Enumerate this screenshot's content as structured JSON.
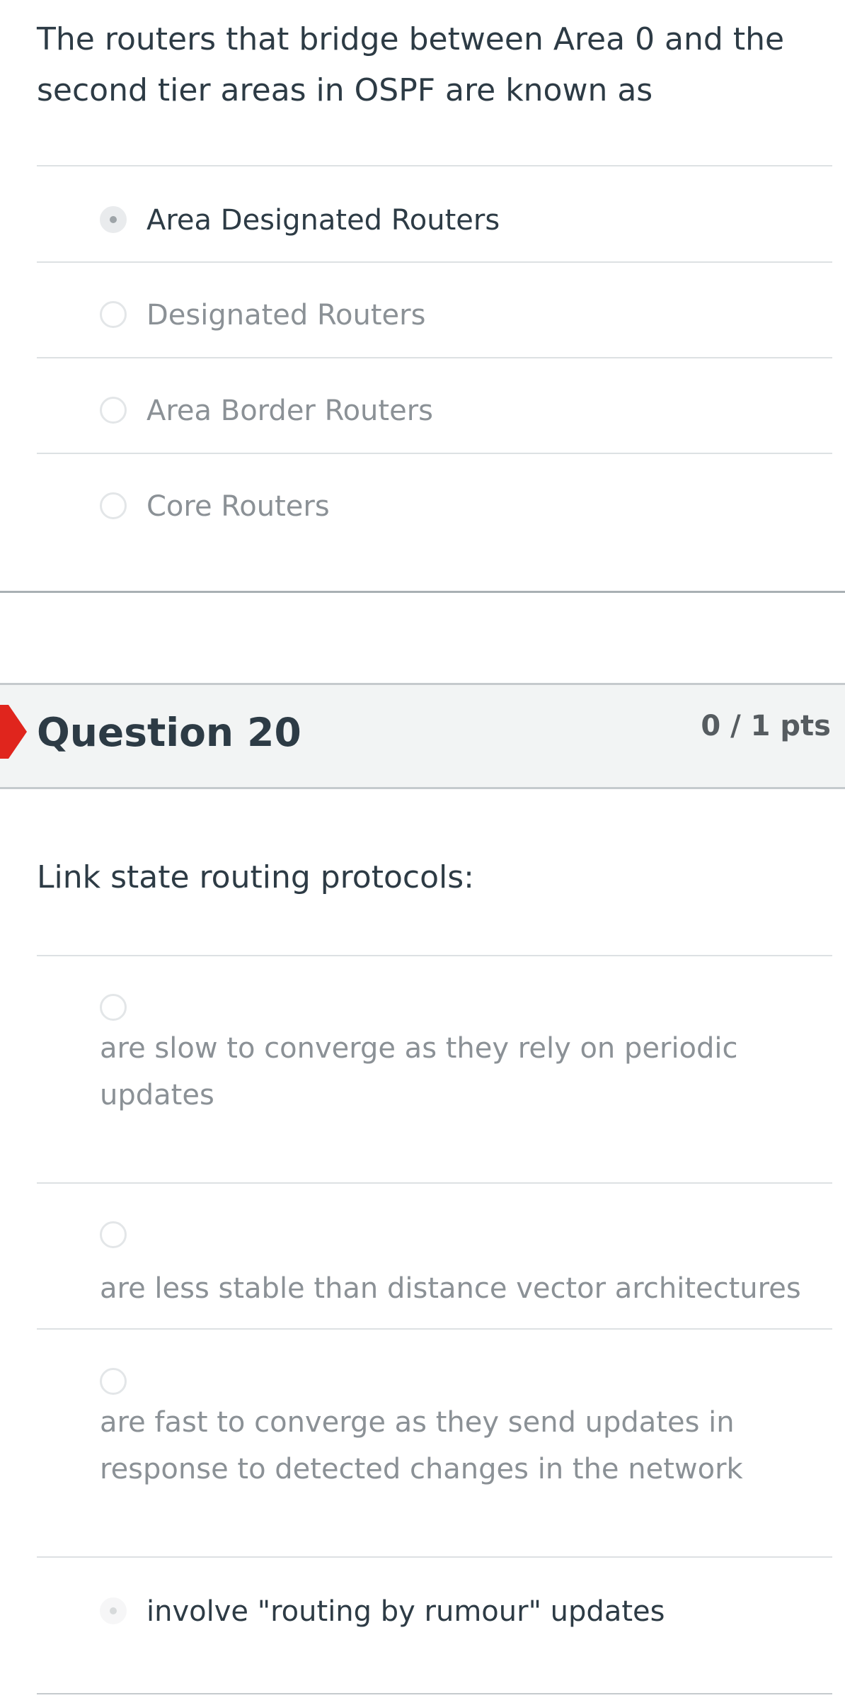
{
  "question19": {
    "text_line1": "The routers that bridge between Area 0 and the",
    "text_line2": "second tier areas in OSPF are known as",
    "answers": [
      {
        "label": "Area Designated Routers",
        "selected": true
      },
      {
        "label": "Designated Routers",
        "selected": false
      },
      {
        "label": "Area Border Routers",
        "selected": false
      },
      {
        "label": "Core Routers",
        "selected": false
      }
    ]
  },
  "question20": {
    "title": "Question 20",
    "points": "0 / 1 pts",
    "text": "Link state routing protocols:",
    "answers": [
      {
        "line1": "are slow to converge as they rely on periodic",
        "line2": "updates",
        "selected": false
      },
      {
        "line1": "are less stable than distance vector architectures",
        "line2": "",
        "selected": false
      },
      {
        "line1": "are fast to converge as they send updates in",
        "line2": "response to detected changes in the network",
        "selected": false
      },
      {
        "line1": "involve \"routing by rumour\" updates",
        "line2": "",
        "selected": true
      }
    ]
  },
  "colors": {
    "incorrect_flag": "#e0251d",
    "text": "#2d3b45",
    "muted_text": "#8b9196",
    "header_bg": "#f2f4f4"
  },
  "icons": {
    "incorrect_marker": "incorrect-answer-flag-icon"
  }
}
